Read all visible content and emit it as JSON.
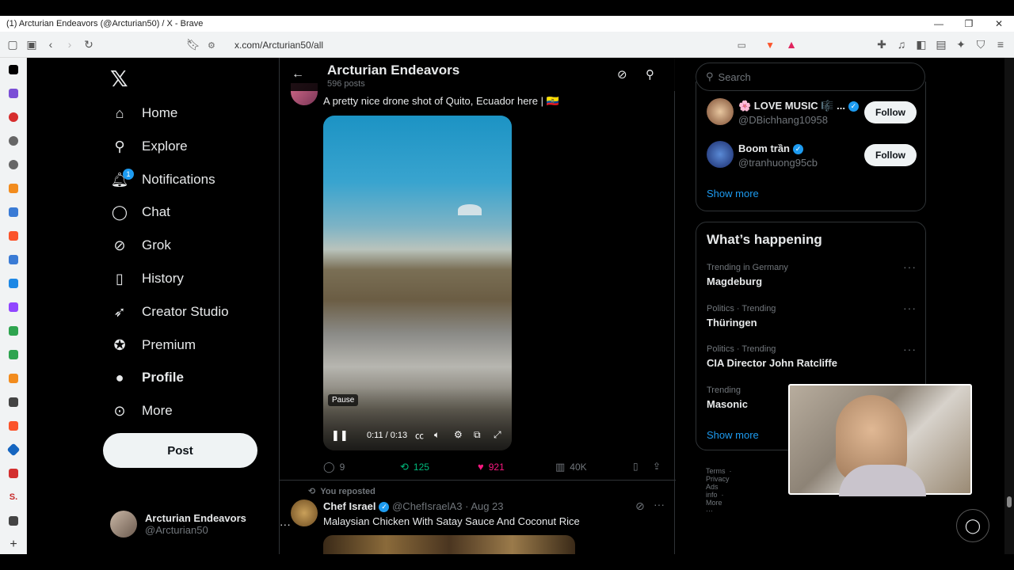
{
  "window": {
    "title": "(1) Arcturian Endeavors (@Arcturian50) / X - Brave"
  },
  "browser": {
    "url": "x.com/Arcturian50/all"
  },
  "nav": {
    "items": [
      {
        "label": "Home",
        "icon": "home-icon"
      },
      {
        "label": "Explore",
        "icon": "search-icon"
      },
      {
        "label": "Notifications",
        "icon": "bell-icon",
        "badge": "1"
      },
      {
        "label": "Chat",
        "icon": "chat-icon"
      },
      {
        "label": "Grok",
        "icon": "grok-icon"
      },
      {
        "label": "History",
        "icon": "bookmark-icon"
      },
      {
        "label": "Creator Studio",
        "icon": "rocket-icon"
      },
      {
        "label": "Premium",
        "icon": "verified-icon"
      },
      {
        "label": "Profile",
        "icon": "person-icon"
      },
      {
        "label": "More",
        "icon": "more-circle-icon"
      }
    ],
    "post_label": "Post",
    "account": {
      "name": "Arcturian Endeavors",
      "handle": "@Arcturian50"
    }
  },
  "profile_header": {
    "name": "Arcturian Endeavors",
    "posts": "596 posts"
  },
  "tweet1": {
    "text": "A pretty nice drone shot of Quito, Ecuador here | 🇪🇨",
    "video": {
      "tooltip": "Pause",
      "time": "0:11 / 0:13",
      "progress": 0.85
    },
    "actions": {
      "replies": "9",
      "reposts": "125",
      "likes": "921",
      "views": "40K"
    }
  },
  "tweet2": {
    "context": "You reposted",
    "name": "Chef Israel",
    "handle": "@ChefIsraelA3",
    "date": "· Aug 23",
    "text": "Malaysian Chicken With Satay Sauce And Coconut Rice"
  },
  "sidebar": {
    "search_placeholder": "Search",
    "who_to_follow": [
      {
        "name": "🌸 LOVE MUSIC 🎼 ...",
        "handle": "@DBichhang10958",
        "button": "Follow"
      },
      {
        "name": "Boom trần",
        "handle": "@tranhuong95cb",
        "button": "Follow"
      }
    ],
    "show_more": "Show more",
    "happening_title": "What’s happening",
    "trends": [
      {
        "category": "Trending in Germany",
        "name": "Magdeburg"
      },
      {
        "category": "Politics · Trending",
        "name": "Thüringen"
      },
      {
        "category": "Politics · Trending",
        "name": "CIA Director John Ratcliffe"
      },
      {
        "category": "Trending",
        "name": "Masonic"
      }
    ],
    "show_more_2": "Show more",
    "footer": {
      "terms": "Terms",
      "privacy": "Privacy",
      "ads": "Ads info",
      "more": "More ···"
    }
  }
}
